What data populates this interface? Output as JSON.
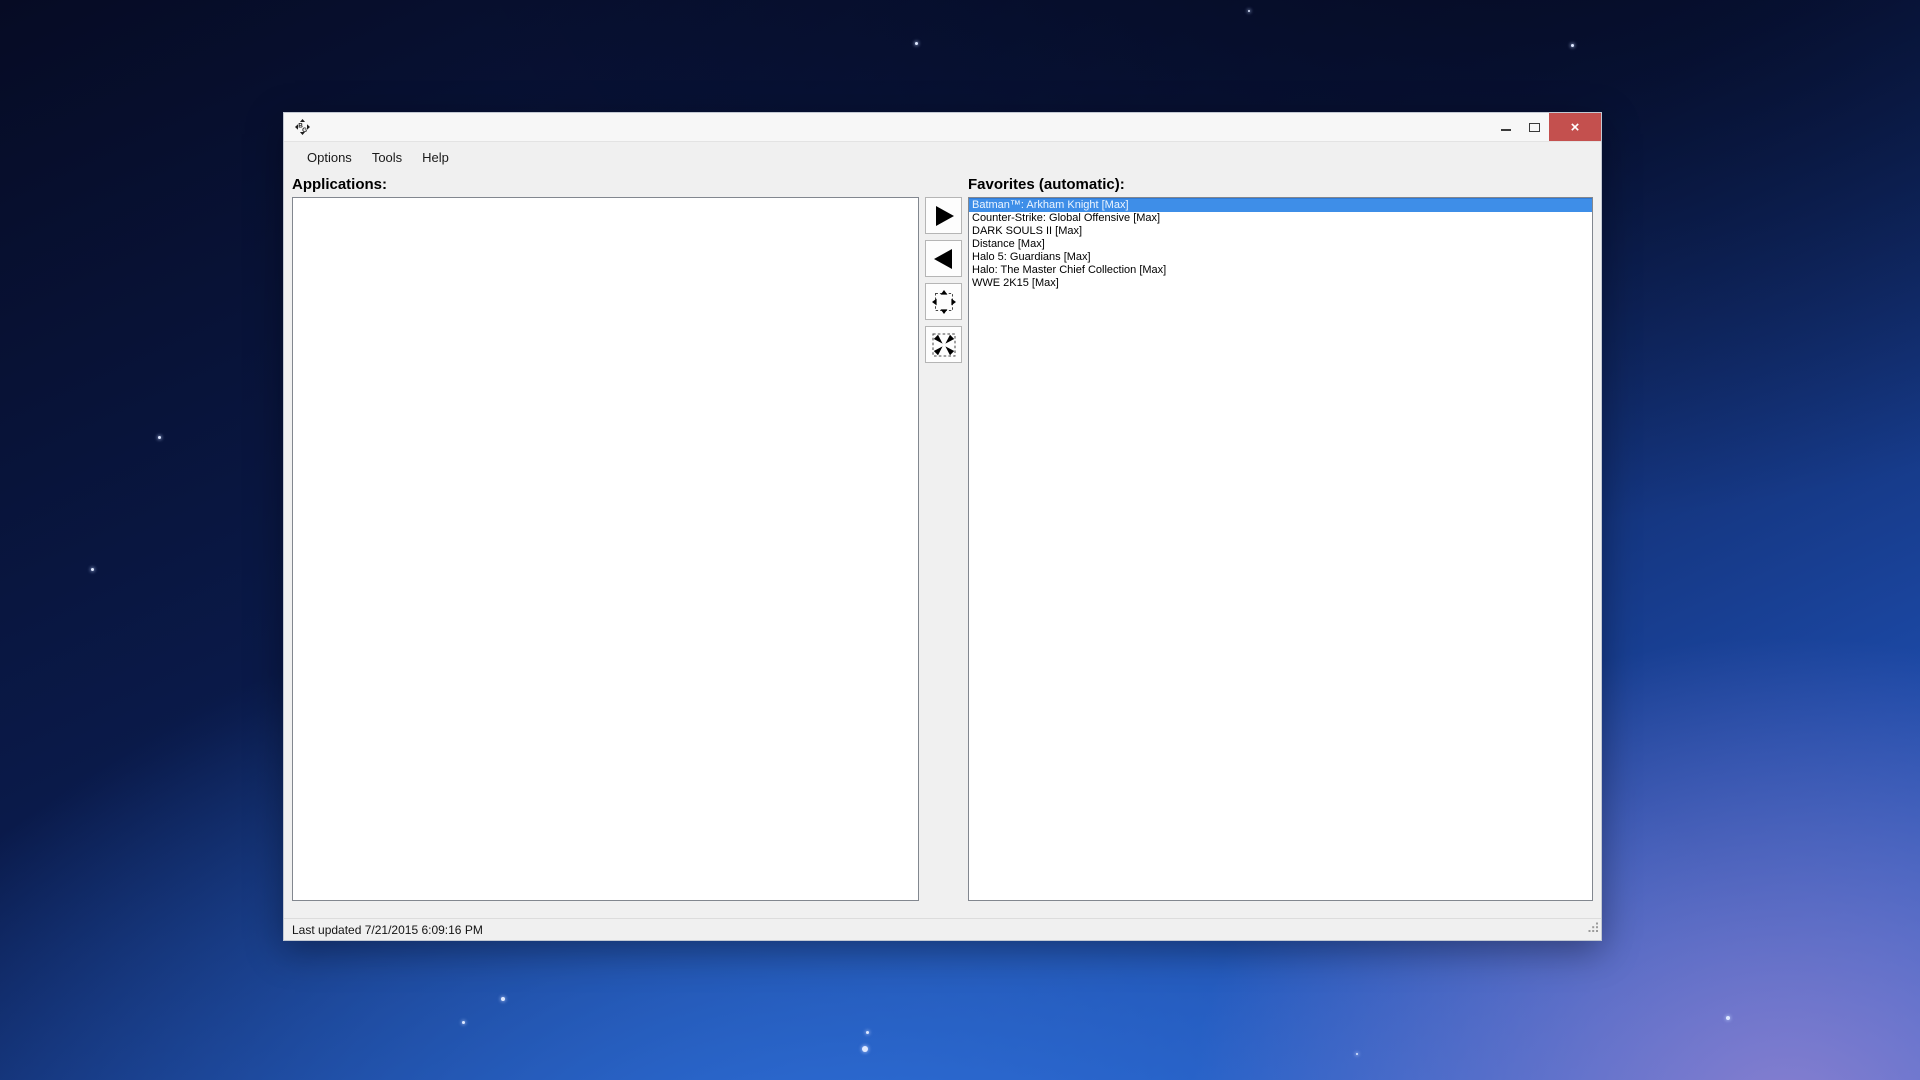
{
  "window": {
    "title": "",
    "caption": {
      "close_glyph": "×"
    },
    "menu": {
      "items": [
        {
          "label": "Options"
        },
        {
          "label": "Tools"
        },
        {
          "label": "Help"
        }
      ]
    },
    "applications_panel": {
      "label": "Applications:",
      "items": []
    },
    "favorites_panel": {
      "label": "Favorites (automatic):",
      "selected_index": 0,
      "items": [
        {
          "label": "Batman™: Arkham Knight [Max]"
        },
        {
          "label": "Counter-Strike: Global Offensive [Max]"
        },
        {
          "label": "DARK SOULS II [Max]"
        },
        {
          "label": "Distance [Max]"
        },
        {
          "label": "Halo 5: Guardians [Max]"
        },
        {
          "label": "Halo: The Master Chief Collection [Max]"
        },
        {
          "label": "WWE 2K15 [Max]"
        }
      ]
    },
    "transfer_buttons": [
      {
        "name": "add-to-favorites",
        "icon": "right-arrow-icon"
      },
      {
        "name": "remove-from-favorites",
        "icon": "left-arrow-icon"
      },
      {
        "name": "make-borderless",
        "icon": "expand-arrows-icon"
      },
      {
        "name": "restore-window",
        "icon": "collapse-arrows-icon"
      }
    ],
    "status_bar": {
      "text": "Last updated 7/21/2015 6:09:16 PM"
    }
  },
  "colors": {
    "selection_bg": "#3e8ee8",
    "close_button_bg": "#c4504e",
    "titlebar_bg": "#f7f7f7",
    "window_bg": "#f0f0f0",
    "listbox_border": "#82878f"
  }
}
